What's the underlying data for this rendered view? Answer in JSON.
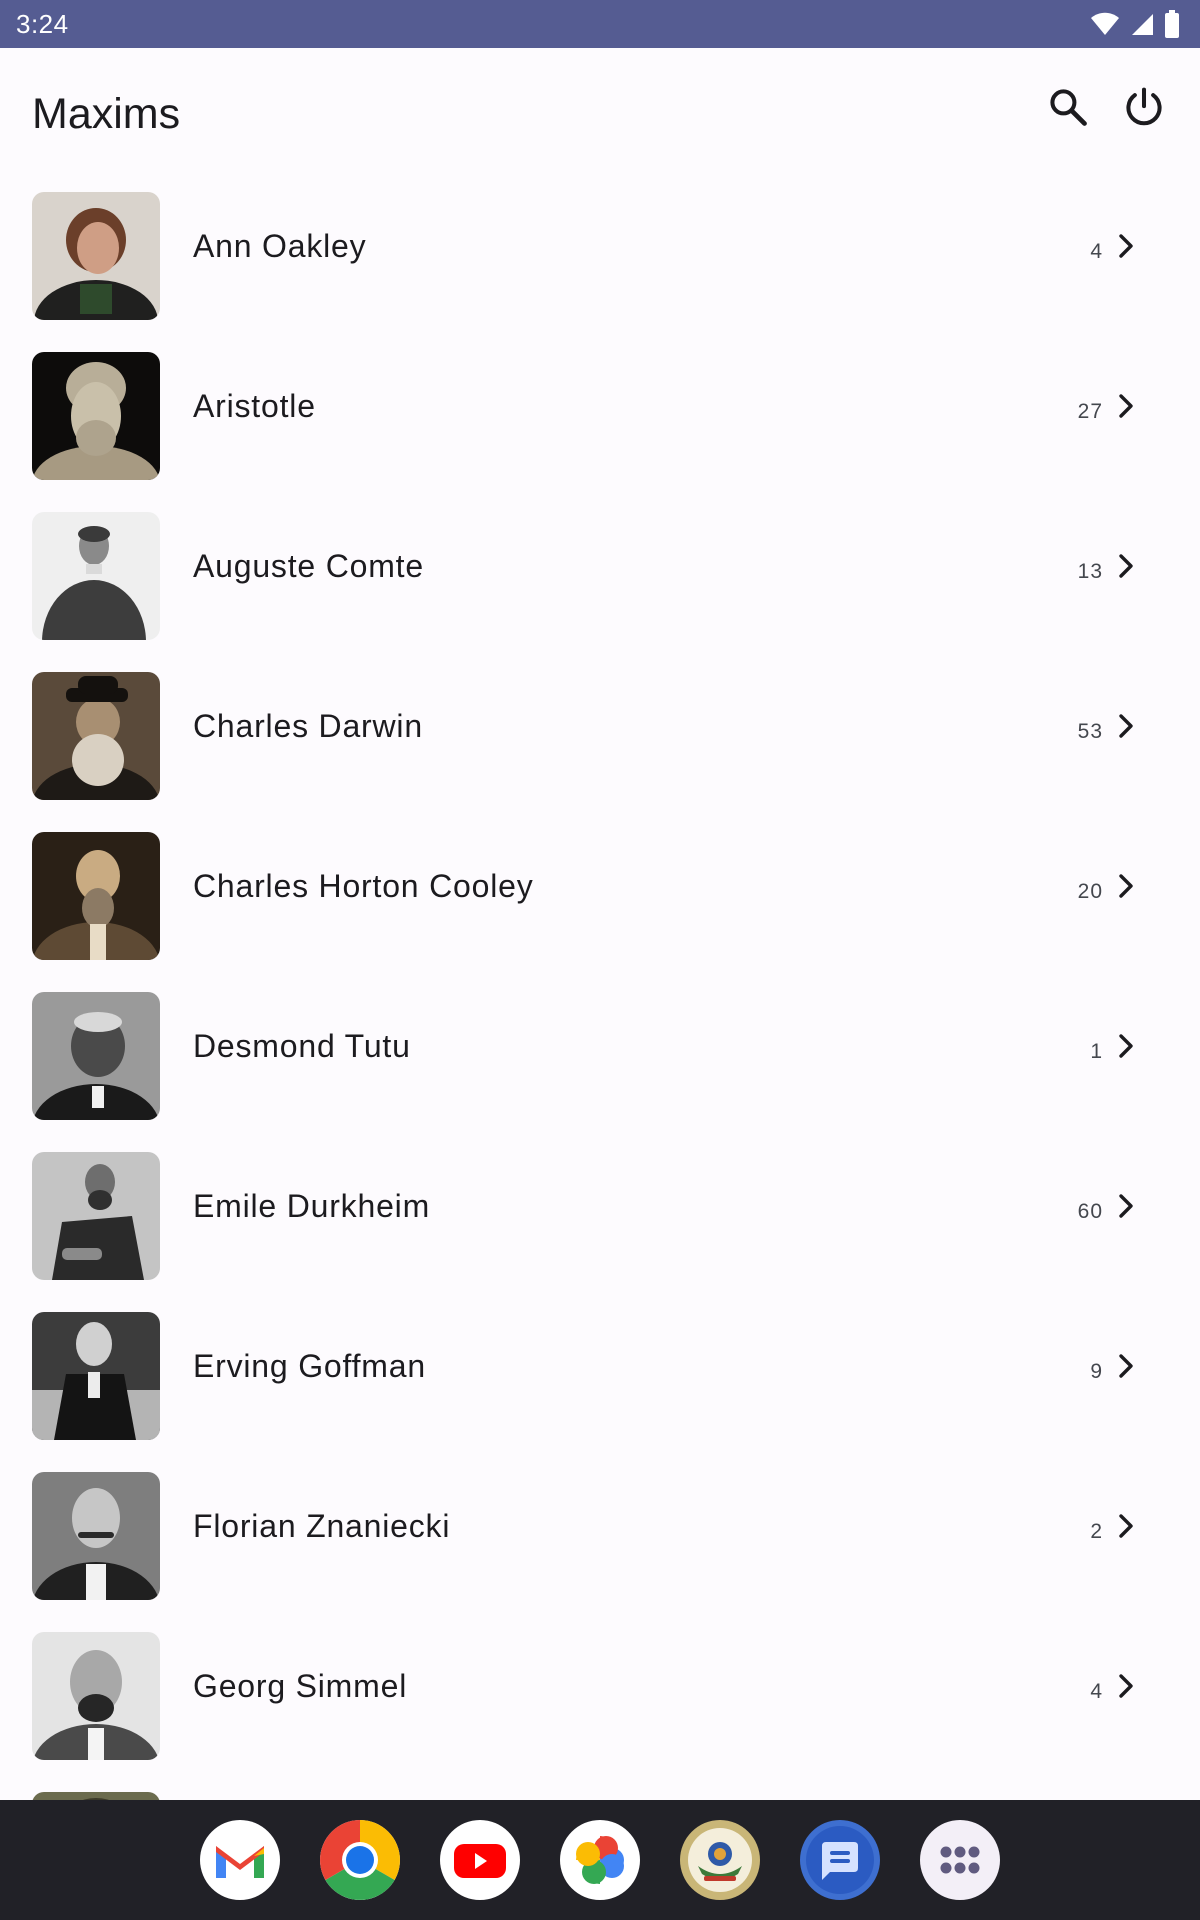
{
  "status_bar": {
    "time": "3:24"
  },
  "app_bar": {
    "title": "Maxims"
  },
  "authors": [
    {
      "name": "Ann Oakley",
      "count": "4"
    },
    {
      "name": "Aristotle",
      "count": "27"
    },
    {
      "name": "Auguste Comte",
      "count": "13"
    },
    {
      "name": "Charles Darwin",
      "count": "53"
    },
    {
      "name": "Charles Horton Cooley",
      "count": "20"
    },
    {
      "name": "Desmond Tutu",
      "count": "1"
    },
    {
      "name": "Emile Durkheim",
      "count": "60"
    },
    {
      "name": "Erving Goffman",
      "count": "9"
    },
    {
      "name": "Florian Znaniecki",
      "count": "2"
    },
    {
      "name": "Georg Simmel",
      "count": "4"
    }
  ],
  "icons": {
    "search": "search-icon",
    "power": "power-icon",
    "chevron": "chevron-right-icon"
  },
  "dock": [
    "gmail",
    "chrome",
    "youtube",
    "photos",
    "emblem-app",
    "messages",
    "app-drawer"
  ],
  "colors": {
    "status_bar": "#555c92",
    "background": "#fdfbfe",
    "dock": "#212127"
  }
}
